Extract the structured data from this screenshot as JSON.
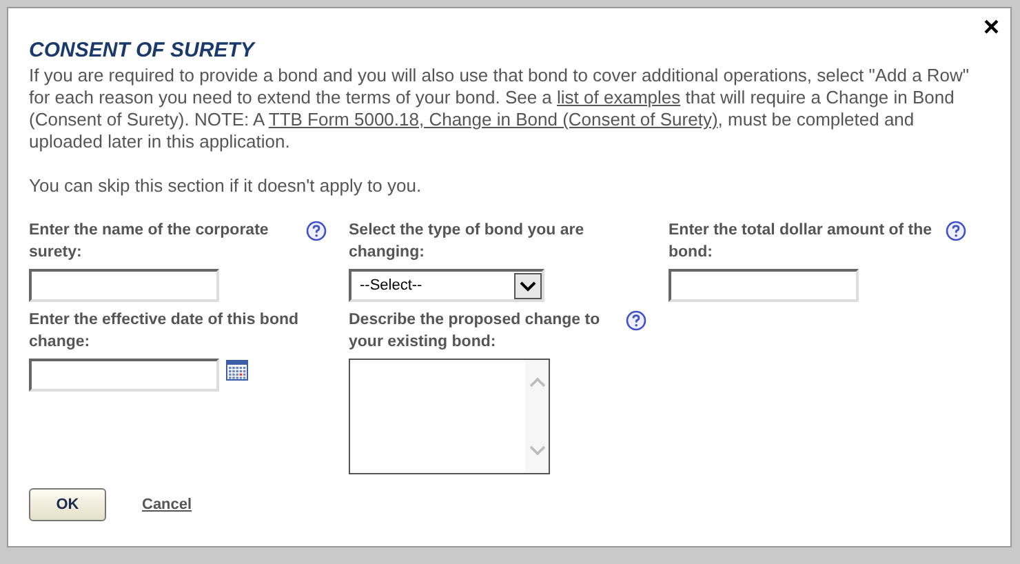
{
  "dialog": {
    "close": "×",
    "title": "CONSENT OF SURETY",
    "intro": [
      {
        "kind": "text",
        "text": "If you are required to provide a bond and you will also use that bond to cover additional operations, select \"Add a Row\" for each reason you need to extend the terms of your bond. See a "
      },
      {
        "kind": "link",
        "text": "list of examples"
      },
      {
        "kind": "text",
        "text": " that will require a Change in Bond (Consent of Surety). NOTE: A "
      },
      {
        "kind": "link",
        "text": "TTB Form 5000.18, Change in Bond (Consent of Surety)"
      },
      {
        "kind": "text",
        "text": ", must be completed and uploaded later in this application."
      }
    ],
    "skip_note": "You can skip this section if it doesn't apply to you.",
    "fields": [
      {
        "kind": "text",
        "label": "Enter the name of the corporate surety:",
        "help": true
      },
      {
        "kind": "select",
        "label": "Select the type of bond you are changing:",
        "value": "--Select--",
        "help": false
      },
      {
        "kind": "text",
        "label": "Enter the total dollar amount of the bond:",
        "help": true
      },
      {
        "kind": "date",
        "label": "Enter the effective date of this bond change:",
        "help": false
      },
      {
        "kind": "textarea",
        "label": "Describe the proposed change to your existing bond:",
        "help": true
      }
    ],
    "ok": "OK",
    "cancel": "Cancel"
  }
}
